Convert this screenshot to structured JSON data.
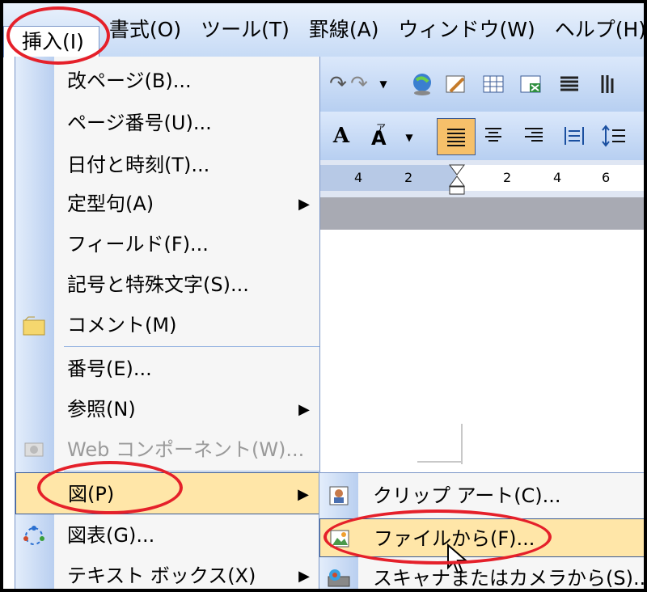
{
  "menubar": {
    "items": [
      {
        "label": "挿入(I)",
        "open": true
      },
      {
        "label": "書式(O)"
      },
      {
        "label": "ツール(T)"
      },
      {
        "label": "罫線(A)"
      },
      {
        "label": "ウィンドウ(W)"
      },
      {
        "label": "ヘルプ(H)"
      }
    ]
  },
  "ruler": {
    "ticks": [
      "4",
      "2",
      "2",
      "4",
      "6"
    ]
  },
  "insert_menu": {
    "items": [
      {
        "label": "改ページ(B)...",
        "icon": null,
        "submenu": false
      },
      {
        "label": "ページ番号(U)...",
        "icon": null,
        "submenu": false
      },
      {
        "label": "日付と時刻(T)...",
        "icon": null,
        "submenu": false
      },
      {
        "label": "定型句(A)",
        "icon": null,
        "submenu": true
      },
      {
        "label": "フィールド(F)...",
        "icon": null,
        "submenu": false
      },
      {
        "label": "記号と特殊文字(S)...",
        "icon": null,
        "submenu": false
      },
      {
        "label": "コメント(M)",
        "icon": "comment-icon",
        "submenu": false
      },
      {
        "label": "番号(E)...",
        "icon": null,
        "submenu": false
      },
      {
        "label": "参照(N)",
        "icon": null,
        "submenu": true
      },
      {
        "label": "Web コンポーネント(W)...",
        "icon": "web-component-icon",
        "submenu": false,
        "disabled": true
      },
      {
        "label": "図(P)",
        "icon": null,
        "submenu": true,
        "highlighted": true
      },
      {
        "label": "図表(G)...",
        "icon": "diagram-icon",
        "submenu": false
      },
      {
        "label": "テキスト ボックス(X)",
        "icon": null,
        "submenu": true
      }
    ]
  },
  "picture_submenu": {
    "items": [
      {
        "label": "クリップ アート(C)...",
        "icon": "clipart-icon"
      },
      {
        "label": "ファイルから(F)...",
        "icon": "from-file-icon",
        "highlighted": true
      },
      {
        "label": "スキャナまたはカメラから(S)...",
        "icon": "scanner-icon"
      }
    ]
  },
  "colors": {
    "highlight": "#ffe6a8",
    "annotation": "#e5202a",
    "menubar": "#c7dbf6"
  }
}
